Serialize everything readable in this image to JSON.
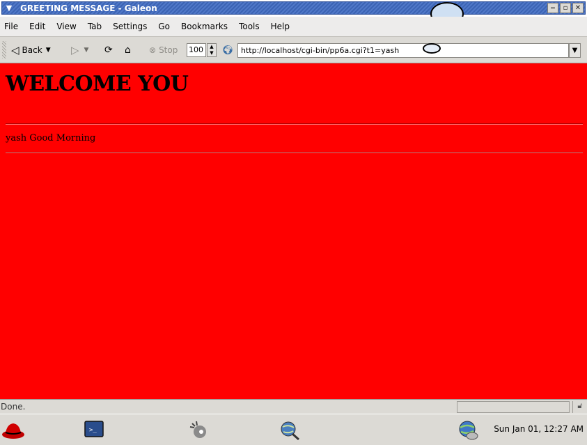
{
  "window": {
    "title": "GREETING MESSAGE - Galeon",
    "controls": {
      "minimize": "‒",
      "maximize": "▫",
      "close": "✕"
    }
  },
  "menubar": {
    "items": [
      "File",
      "Edit",
      "View",
      "Tab",
      "Settings",
      "Go",
      "Bookmarks",
      "Tools",
      "Help"
    ]
  },
  "toolbar": {
    "back_label": "Back",
    "stop_label": "Stop",
    "zoom_value": "100",
    "url": "http://localhost/cgi-bin/pp6a.cgi?t1=yash"
  },
  "page": {
    "heading": "WELCOME YOU",
    "message": "yash Good Morning",
    "background": "#ff0000"
  },
  "status": {
    "text": "Done."
  },
  "panel": {
    "icons": [
      "redhat-menu-icon",
      "terminal-icon",
      "gimp-icon",
      "web-browser-icon"
    ],
    "clock": "Sun Jan 01, 12:27 AM"
  }
}
